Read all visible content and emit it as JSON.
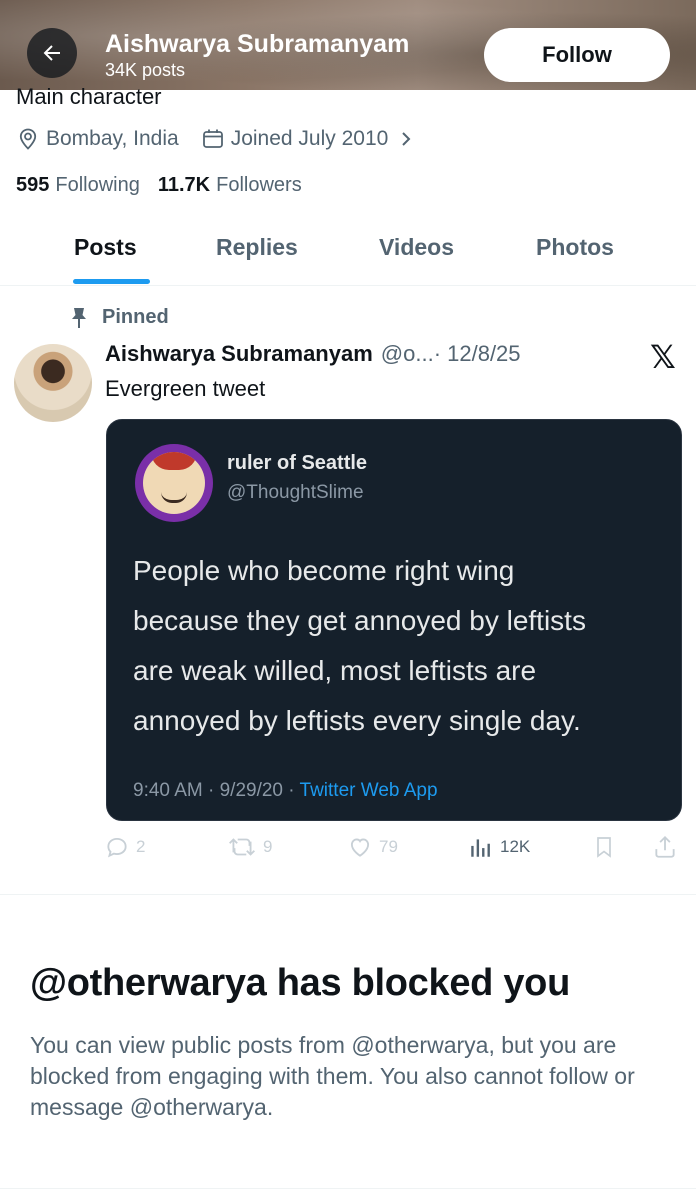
{
  "header": {
    "name": "Aishwarya Subramanyam",
    "post_count": "34K posts",
    "follow_label": "Follow"
  },
  "profile": {
    "bio": "Main character",
    "location": "Bombay, India",
    "joined": "Joined July 2010",
    "following_count": "595",
    "following_label": "Following",
    "followers_count": "11.7K",
    "followers_label": "Followers"
  },
  "tabs": [
    {
      "label": "Posts",
      "active": true
    },
    {
      "label": "Replies",
      "active": false
    },
    {
      "label": "Videos",
      "active": false
    },
    {
      "label": "Photos",
      "active": false
    }
  ],
  "pinned_post": {
    "pinned_label": "Pinned",
    "author_name": "Aishwarya Subramanyam",
    "author_handle": "@o...",
    "date": "· 12/8/25",
    "text": "Evergreen tweet",
    "x_logo": "𝕏",
    "embedded": {
      "name": "ruler of Seattle",
      "handle": "@ThoughtSlime",
      "lines": [
        "People who become right wing",
        "because they get annoyed by leftists",
        "are weak willed, most leftists are",
        "annoyed by leftists every single day."
      ],
      "timestamp": "9:40 AM · 9/29/20 · ",
      "app": "Twitter Web App"
    },
    "actions": {
      "replies": "2",
      "reposts": "9",
      "likes": "79",
      "views": "12K"
    }
  },
  "blocked": {
    "title": "@otherwarya has blocked you",
    "description": "You can view public posts from @otherwarya, but you are blocked from engaging with them. You also cannot follow or message @otherwarya."
  },
  "colors": {
    "accent": "#1d9bf0",
    "text_primary": "#0f1419",
    "text_secondary": "#536471",
    "embed_bg": "#15202b"
  }
}
